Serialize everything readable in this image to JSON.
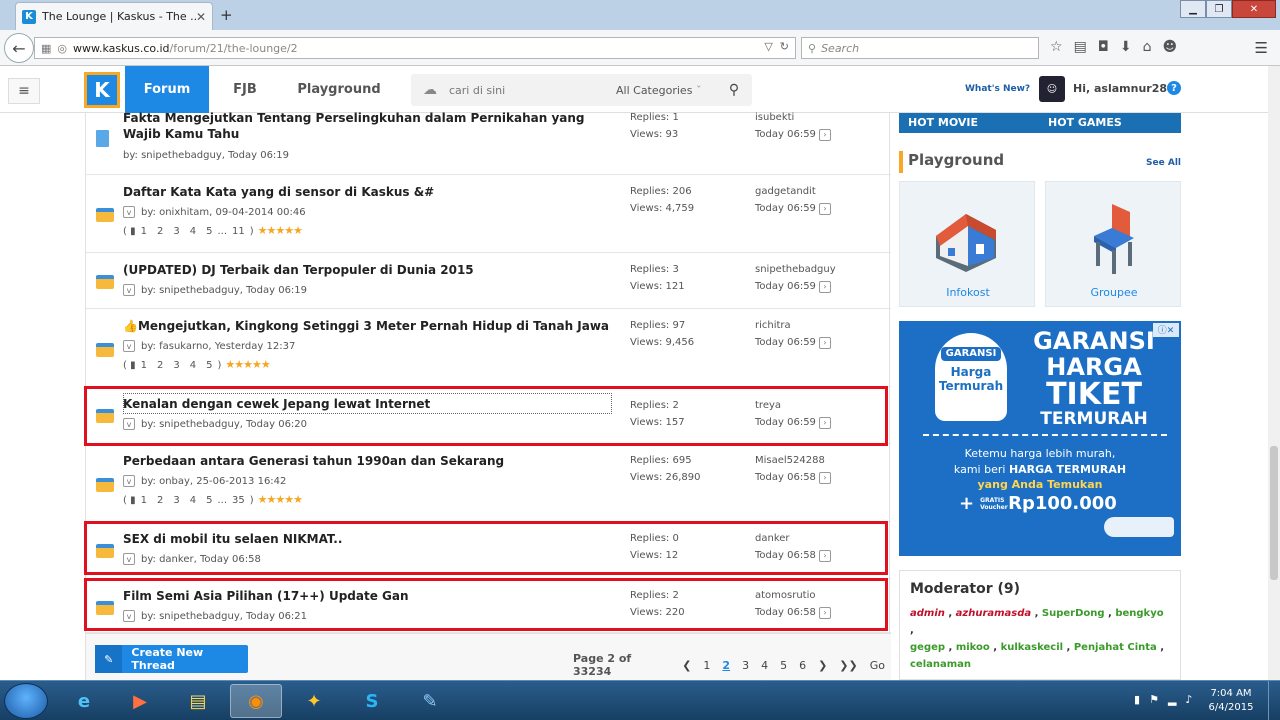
{
  "browser": {
    "tab_title": "The Lounge | Kaskus - The ...",
    "tab_favicon": "K",
    "url_host": "www.kaskus.co.id",
    "url_path": "/forum/21/the-lounge/2",
    "search_placeholder": "Search"
  },
  "site": {
    "nav_tabs": [
      "Forum",
      "FJB",
      "Playground"
    ],
    "search_placeholder": "cari di sini",
    "categories_label": "All Categories",
    "whats_new": "What's New?",
    "greeting": "Hi, aslamnur28",
    "help": "?"
  },
  "threads": [
    {
      "title": "Fakta Mengejutkan Tentang Perselingkuhan dalam Pernikahan yang Wajib Kamu Tahu",
      "meta": "by:  snipethebadguy, Today 06:19",
      "replies": "Replies: 1",
      "views": "Views: 93",
      "last_user": "isubekti",
      "last_time": "Today 06:59"
    },
    {
      "title": "Daftar Kata Kata yang di sensor di Kaskus &#",
      "meta": "by:  onixhitam, 09-04-2014 00:46",
      "pages": [
        "1",
        "2",
        "3",
        "4",
        "5",
        "...",
        "11"
      ],
      "replies": "Replies: 206",
      "views": "Views: 4,759",
      "last_user": "gadgetandit",
      "last_time": "Today 06:59"
    },
    {
      "title": "(UPDATED) DJ Terbaik dan Terpopuler di Dunia 2015",
      "meta": "by:  snipethebadguy, Today 06:19",
      "replies": "Replies: 3",
      "views": "Views: 121",
      "last_user": "snipethebadguy",
      "last_time": "Today 06:59"
    },
    {
      "title": "Mengejutkan, Kingkong Setinggi 3 Meter Pernah Hidup di Tanah Jawa",
      "meta": "by:  fasukarno, Yesterday 12:37",
      "pages": [
        "1",
        "2",
        "3",
        "4",
        "5"
      ],
      "replies": "Replies: 97",
      "views": "Views: 9,456",
      "last_user": "richitra",
      "last_time": "Today 06:59"
    },
    {
      "title": "Kenalan dengan cewek Jepang lewat Internet",
      "meta": "by:  snipethebadguy, Today 06:20",
      "replies": "Replies: 2",
      "views": "Views: 157",
      "last_user": "treya",
      "last_time": "Today 06:59"
    },
    {
      "title": "Perbedaan antara Generasi tahun 1990an dan Sekarang",
      "meta": "by:  onbay, 25-06-2013 16:42",
      "pages": [
        "1",
        "2",
        "3",
        "4",
        "5",
        "...",
        "35"
      ],
      "replies": "Replies: 695",
      "views": "Views: 26,890",
      "last_user": "Misael524288",
      "last_time": "Today 06:58"
    },
    {
      "title": "SEX di mobil itu selaen NIKMAT..",
      "meta": "by:  danker, Today 06:58",
      "replies": "Replies: 0",
      "views": "Views: 12",
      "last_user": "danker",
      "last_time": "Today 06:58"
    },
    {
      "title": "Film Semi Asia Pilihan (17++) Update Gan",
      "meta": "by:  snipethebadguy, Today 06:21",
      "replies": "Replies: 2",
      "views": "Views: 220",
      "last_user": "atomosrutio",
      "last_time": "Today 06:58"
    }
  ],
  "footer": {
    "create_thread": "Create New Thread",
    "page_info": "Page 2 of 33234",
    "pages": [
      "1",
      "2",
      "3",
      "4",
      "5",
      "6"
    ],
    "go": "Go"
  },
  "sidebar": {
    "hot_movie": "HOT MOVIE",
    "hot_games": "HOT GAMES",
    "playground_title": "Playground",
    "see_all": "See All",
    "cards": [
      "Infokost",
      "Groupee"
    ],
    "ad": {
      "badge_head": "GARANSI",
      "badge_line1": "Harga",
      "badge_line2": "Termurah",
      "line1": "GARANSI",
      "line2": "HARGA",
      "line3": "TIKET",
      "line4": "TERMURAH",
      "sub1": "Ketemu harga lebih murah,",
      "sub2_a": "kami beri ",
      "sub2_b": "HARGA TERMURAH",
      "sub3": "yang Anda Temukan",
      "gratis": "GRATIS Voucher",
      "amount": "Rp100.000"
    },
    "moderator_title": "Moderator (9)",
    "moderators": [
      "admin",
      "azhuramasda",
      "SuperDong",
      "bengkyo",
      "gegep",
      "mikoo",
      "kulkaskecil",
      "Penjahat Cinta",
      "celanaman"
    ]
  },
  "taskbar": {
    "time": "7:04 AM",
    "date": "6/4/2015"
  },
  "colors": {
    "brand": "#1e88e5",
    "highlight": "#e0101e",
    "logo_border": "#f9a825"
  }
}
